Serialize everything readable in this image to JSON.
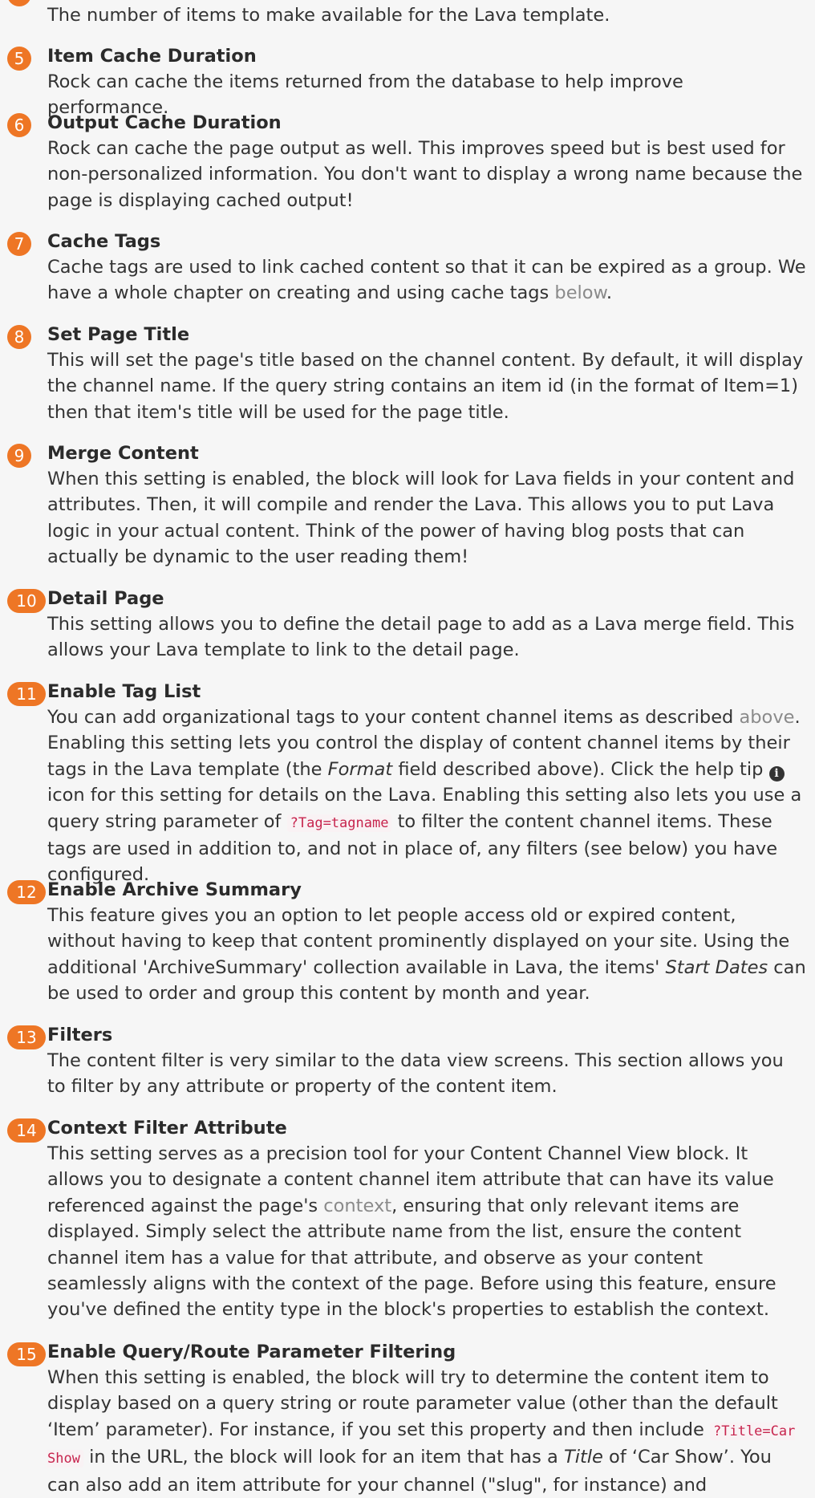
{
  "item4": {
    "desc": "The number of items to make available for the Lava template."
  },
  "item5": {
    "num": "5",
    "title": "Item Cache Duration",
    "desc": "Rock can cache the items returned from the database to help improve performance."
  },
  "item6": {
    "num": "6",
    "title": "Output Cache Duration",
    "desc": "Rock can cache the page output as well. This improves speed but is best used for non-personalized information. You don't want to display a wrong name because the page is displaying cached output!"
  },
  "item7": {
    "num": "7",
    "title": "Cache Tags",
    "desc_before": "Cache tags are used to link cached content so that it can be expired as a group. We have a whole chapter on creating and using cache tags ",
    "link": "below",
    "desc_after": "."
  },
  "item8": {
    "num": "8",
    "title": "Set Page Title",
    "desc": "This will set the page's title based on the channel content. By default, it will display the channel name. If the query string contains an item id (in the format of Item=1) then that item's title will be used for the page title."
  },
  "item9": {
    "num": "9",
    "title": "Merge Content",
    "desc": "When this setting is enabled, the block will look for Lava fields in your content and attributes. Then, it will compile and render the Lava. This allows you to put Lava logic in your actual content. Think of the power of having blog posts that can actually be dynamic to the user reading them!"
  },
  "item10": {
    "num": "10",
    "title": "Detail Page",
    "desc": "This setting allows you to define the detail page to add as a Lava merge field. This allows your Lava template to link to the detail page."
  },
  "item11": {
    "num": "11",
    "title": "Enable Tag List",
    "p1": "You can add organizational tags to your content channel items as described ",
    "link": "above",
    "p2": ". Enabling this setting lets you control the display of content channel items by their tags in the Lava template (the ",
    "em": "Format",
    "p3": " field described above). Click the help tip ",
    "icon_glyph": "i",
    "p4": " icon for this setting for details on the Lava. Enabling this setting also lets you use a query string parameter of ",
    "code": "?Tag=tagname",
    "p5": " to filter the content channel items. These tags are used in addition to, and not in place of, any filters (see below) you have configured."
  },
  "item12": {
    "num": "12",
    "title": "Enable Archive Summary",
    "p1": "This feature gives you an option to let people access old or expired content, without having to keep that content prominently displayed on your site. Using the additional 'ArchiveSummary' collection available in Lava, the items' ",
    "em": "Start Dates",
    "p2": " can be used to order and group this content by month and year."
  },
  "item13": {
    "num": "13",
    "title": "Filters",
    "desc": "The content filter is very similar to the data view screens. This section allows you to filter by any attribute or property of the content item."
  },
  "item14": {
    "num": "14",
    "title": "Context Filter Attribute",
    "p1": "This setting serves as a precision tool for your Content Channel View block. It allows you to designate a content channel item attribute that can have its value referenced against the page's ",
    "link": "context",
    "p2": ", ensuring that only relevant items are displayed. Simply select the attribute name from the list, ensure the content channel item has a value for that attribute, and observe as your content seamlessly aligns with the context of the page. Before using this feature, ensure you've defined the entity type in the block's properties to establish the context."
  },
  "item15": {
    "num": "15",
    "title": "Enable Query/Route Parameter Filtering",
    "p1": "When this setting is enabled, the block will try to determine the content item to display based on a query string or route parameter value (other than the default ‘Item’ parameter). For instance, if you set this property and then include ",
    "code": "?Title=Car Show",
    "p2": " in the URL, the block will look for an item that has a ",
    "em": "Title",
    "p3": " of ‘Car Show’. You can also add an item attribute for your channel (\"slug\", for instance) and"
  }
}
